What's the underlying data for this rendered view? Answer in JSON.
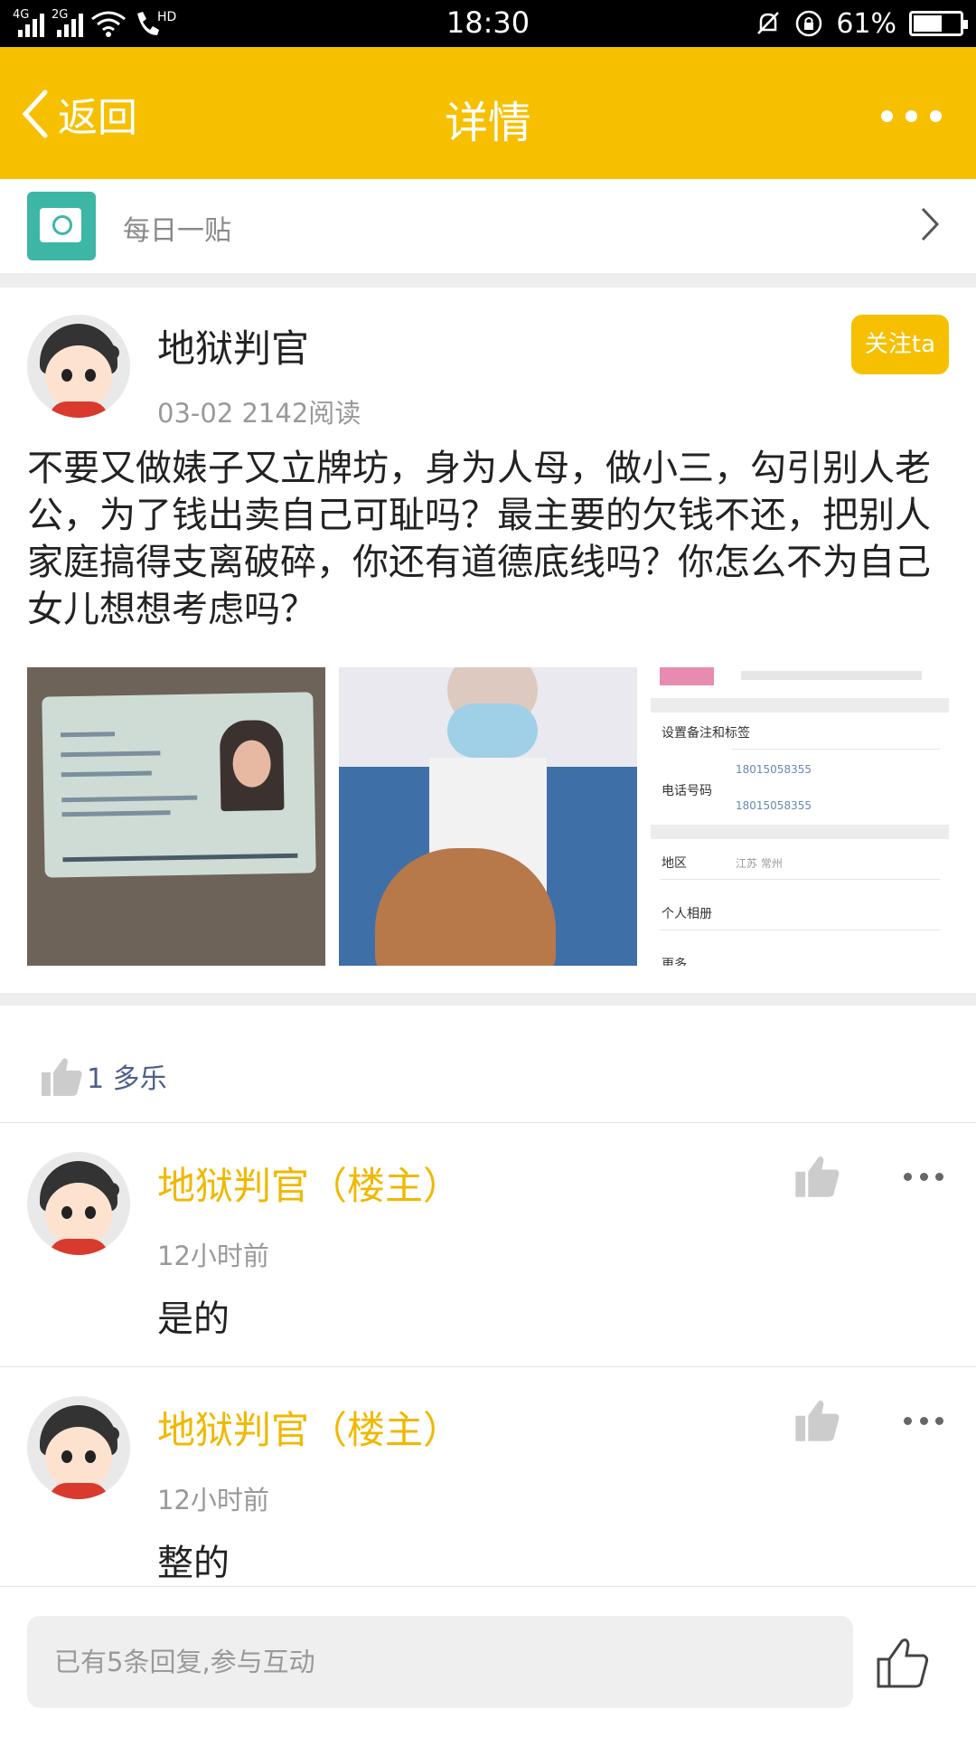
{
  "status_bar": {
    "net1": "4G",
    "net2": "2G",
    "wifi_icon": "wifi-icon",
    "hd_label": "HD",
    "time": "18:30",
    "battery_percent": "61%",
    "battery_level": 0.61
  },
  "nav": {
    "back_label": "返回",
    "title": "详情"
  },
  "category": {
    "label": "每日一贴"
  },
  "post": {
    "author": "地狱判官",
    "meta": "03-02  2142阅读",
    "follow_label": "关注ta",
    "text": "不要又做婊子又立牌坊，身为人母，做小三，勾引别人老公，为了钱出卖自己可耻吗？最主要的欠钱不还，把别人家庭搞得支离破碎，你还有道德底线吗？你怎么不为自己女儿想想考虑吗？",
    "likes": "1 多乐"
  },
  "thumbs": {
    "t3": {
      "row1": "设置备注和标签",
      "phone_label": "电话号码",
      "phone1": "18015058355",
      "phone2": "18015058355",
      "region_label": "地区",
      "region_value": "江苏 常州",
      "album_label": "个人相册",
      "more_label": "更多"
    }
  },
  "comments": [
    {
      "name": "地狱判官（楼主）",
      "time": "12小时前",
      "text": "是的"
    },
    {
      "name": "地狱判官（楼主）",
      "time": "12小时前",
      "text": "整的"
    }
  ],
  "bottom": {
    "placeholder": "已有5条回复,参与互动"
  },
  "colors": {
    "accent": "#f6c000",
    "comment_name": "#f0b800",
    "category_icon": "#3db6a6"
  }
}
